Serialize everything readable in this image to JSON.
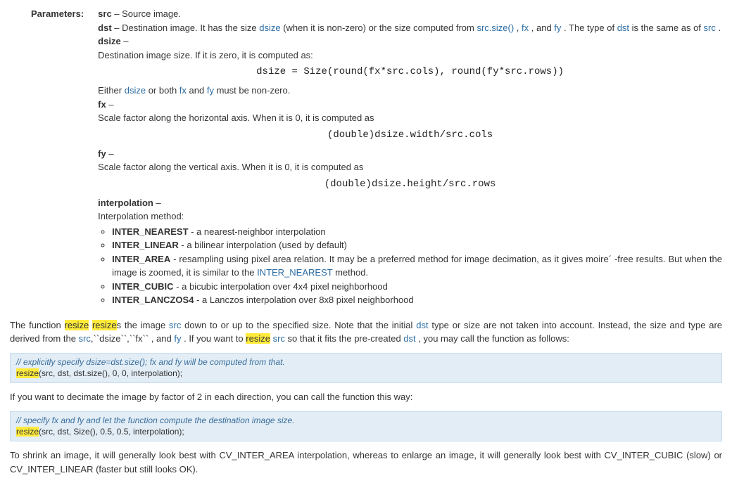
{
  "params_label": "Parameters:",
  "params": {
    "src": {
      "name": "src",
      "desc": " – Source image."
    },
    "dst": {
      "name": "dst",
      "d1": " – Destination image. It has the size ",
      "t1": "dsize",
      "d2": " (when it is non-zero) or the size computed from ",
      "t2": "src.size()",
      "d3": " , ",
      "t3": "fx",
      "d4": " , and ",
      "t4": "fy",
      "d5": " . The type of ",
      "t5": "dst",
      "d6": " is the same as of ",
      "t6": "src",
      "d7": " ."
    },
    "dsize": {
      "name": "dsize",
      "dash": " –",
      "d1": "Destination image size. If it is zero, it is computed as:",
      "formula": "dsize = Size(round(fx*src.cols), round(fy*src.rows))",
      "e1": "Either ",
      "t1": "dsize",
      "e2": " or both ",
      "t2": "fx",
      "e3": " and ",
      "t3": "fy",
      "e4": " must be non-zero."
    },
    "fx": {
      "name": "fx",
      "dash": " –",
      "d1": "Scale factor along the horizontal axis. When it is 0, it is computed as",
      "formula": "(double)dsize.width/src.cols"
    },
    "fy": {
      "name": "fy",
      "dash": " –",
      "d1": "Scale factor along the vertical axis. When it is 0, it is computed as",
      "formula": "(double)dsize.height/src.rows"
    },
    "interp": {
      "name": "interpolation",
      "dash": " –",
      "d1": "Interpolation method:",
      "items": [
        {
          "n": "INTER_NEAREST",
          "d": " - a nearest-neighbor interpolation"
        },
        {
          "n": "INTER_LINEAR",
          "d": " - a bilinear interpolation (used by default)"
        },
        {
          "n": "INTER_AREA",
          "d": " - resampling using pixel area relation. It may be a preferred method for image decimation, as it gives moire´ -free results. But when the image is zoomed, it is similar to the ",
          "t": "INTER_NEAREST",
          "d2": " method."
        },
        {
          "n": "INTER_CUBIC",
          "d": " - a bicubic interpolation over 4x4 pixel neighborhood"
        },
        {
          "n": "INTER_LANCZOS4",
          "d": " - a Lanczos interpolation over 8x8 pixel neighborhood"
        }
      ]
    }
  },
  "body": {
    "p1": {
      "a": "The function ",
      "h1": "resize",
      "sp": " ",
      "h2": "resize",
      "b": "s the image ",
      "t1": "src",
      "c": " down to or up to the specified size. Note that the initial ",
      "t2": "dst",
      "d": " type or size are not taken into account. Instead, the size and type are derived from the ",
      "t3": "src",
      "e": ",``dsize``,``fx`` , and ",
      "t4": "fy",
      "f": " . If you want to ",
      "h3": "resize",
      "g": " ",
      "t5": "src",
      "h": " so that it fits the pre-created ",
      "t6": "dst",
      "i": " , you may call the function as follows:"
    },
    "code1": {
      "c": "// explicitly specify dsize=dst.size(); fx and fy will be computed from that.",
      "h": "resize",
      "l": "(src, dst, dst.size(), 0, 0, interpolation);"
    },
    "p2": "If you want to decimate the image by factor of 2 in each direction, you can call the function this way:",
    "code2": {
      "c": "// specify fx and fy and let the function compute the destination image size.",
      "h": "resize",
      "l": "(src, dst, Size(), 0.5, 0.5, interpolation);"
    },
    "p3": "To shrink an image, it will generally look best with CV_INTER_AREA interpolation, whereas to enlarge an image, it will generally look best with CV_INTER_CUBIC (slow) or CV_INTER_LINEAR (faster but still looks OK)."
  }
}
